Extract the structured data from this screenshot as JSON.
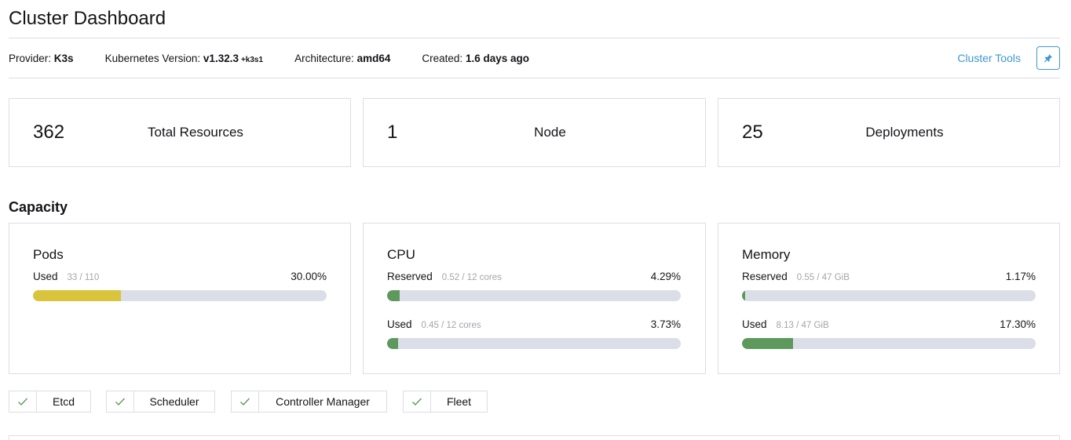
{
  "page": {
    "title": "Cluster Dashboard"
  },
  "meta": {
    "provider_label": "Provider:",
    "provider_value": "K3s",
    "k8s_label": "Kubernetes Version:",
    "k8s_value": "v1.32.3",
    "k8s_suffix": "+k3s1",
    "arch_label": "Architecture:",
    "arch_value": "amd64",
    "created_label": "Created:",
    "created_value": "1.6 days ago",
    "cluster_tools": "Cluster Tools",
    "pin_icon": "pin-icon"
  },
  "counts": [
    {
      "value": "362",
      "label": "Total Resources"
    },
    {
      "value": "1",
      "label": "Node"
    },
    {
      "value": "25",
      "label": "Deployments"
    }
  ],
  "capacity": {
    "title": "Capacity",
    "pods": {
      "title": "Pods",
      "used": {
        "label": "Used",
        "detail": "33 / 110",
        "pct": "30.00%",
        "fraction": 0.3,
        "color": "#d9c43c"
      }
    },
    "cpu": {
      "title": "CPU",
      "reserved": {
        "label": "Reserved",
        "detail": "0.52 / 12 cores",
        "pct": "4.29%",
        "fraction": 0.0429,
        "color": "#5d995d"
      },
      "used": {
        "label": "Used",
        "detail": "0.45 / 12 cores",
        "pct": "3.73%",
        "fraction": 0.0373,
        "color": "#5d995d"
      }
    },
    "memory": {
      "title": "Memory",
      "reserved": {
        "label": "Reserved",
        "detail": "0.55 / 47 GiB",
        "pct": "1.17%",
        "fraction": 0.0117,
        "color": "#5d995d"
      },
      "used": {
        "label": "Used",
        "detail": "8.13 / 47 GiB",
        "pct": "17.30%",
        "fraction": 0.173,
        "color": "#5d995d"
      }
    }
  },
  "health": [
    {
      "label": "Etcd",
      "icon": "check-icon"
    },
    {
      "label": "Scheduler",
      "icon": "check-icon"
    },
    {
      "label": "Controller Manager",
      "icon": "check-icon"
    },
    {
      "label": "Fleet",
      "icon": "check-icon"
    }
  ],
  "colors": {
    "accent": "#3d98d3",
    "ok": "#5d995d",
    "warn": "#d9c43c",
    "border": "#dcdee7"
  }
}
